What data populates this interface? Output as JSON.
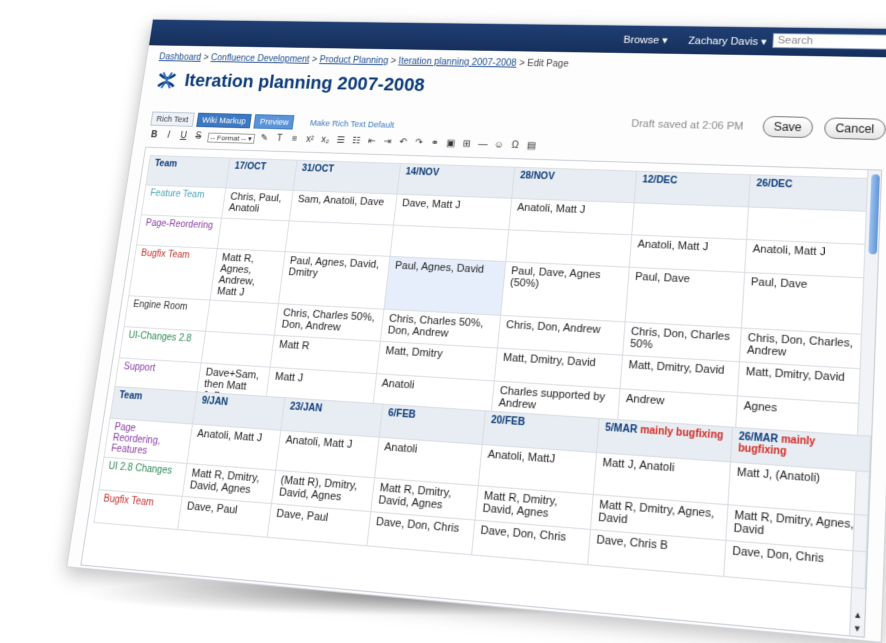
{
  "topbar": {
    "browse": "Browse ▾",
    "user": "Zachary Davis ▾",
    "search_placeholder": "Search"
  },
  "breadcrumb": {
    "items": [
      "Dashboard",
      "Confluence Development",
      "Product Planning",
      "Iteration planning 2007-2008"
    ],
    "sep": " > ",
    "current": "Edit Page"
  },
  "page_title": "Iteration planning 2007-2008",
  "editor_tabs": {
    "rich": "Rich Text",
    "wiki": "Wiki Markup",
    "preview": "Preview",
    "make_default": "Make Rich Text Default"
  },
  "draft_status": "Draft saved at 2:06 PM",
  "buttons": {
    "save": "Save",
    "cancel": "Cancel"
  },
  "format_select": "-- Format -- ▾",
  "colors": {
    "accent": "#0b3a78",
    "link": "#3560a9",
    "highlight": "#d22a22"
  },
  "table1": {
    "headers": [
      "Team",
      "17/OCT",
      "31/OCT",
      "14/NOV",
      "28/NOV",
      "12/DEC",
      "26/DEC"
    ],
    "rows": [
      [
        "Feature Team",
        "Chris, Paul, Anatoli",
        "Sam, Anatoli, Dave",
        "Dave, Matt J",
        "Anatoli, Matt J",
        "",
        ""
      ],
      [
        "Page-Reordering",
        "",
        "",
        "",
        "",
        "Anatoli, Matt J",
        "Anatoli, Matt J"
      ],
      [
        "Bugfix Team",
        "Matt R, Agnes, Andrew, Matt J",
        "Paul, Agnes, David, Dmitry",
        "Paul, Agnes, David",
        "Paul, Dave, Agnes (50%)",
        "Paul, Dave",
        "Paul, Dave"
      ],
      [
        "Engine Room",
        "",
        "Chris, Charles 50%, Don, Andrew",
        "Chris, Charles 50%, Don, Andrew",
        "Chris, Don, Andrew",
        "Chris, Don, Charles 50%",
        "Chris, Don, Charles, Andrew"
      ],
      [
        "UI-Changes 2.8",
        "",
        "Matt R",
        "Matt, Dmitry",
        "Matt, Dmitry, David",
        "Matt, Dmitry, David",
        "Matt, Dmitry, David"
      ],
      [
        "Support",
        "Dave+Sam, then Matt J+Don",
        "Matt J",
        "Anatoli",
        "Charles supported by Andrew",
        "Andrew",
        "Agnes"
      ]
    ]
  },
  "table2": {
    "headers": [
      "Team",
      "9/JAN",
      "23/JAN",
      "6/FEB",
      "20/FEB",
      "5/MAR",
      "26/MAR"
    ],
    "header_notes": {
      "5": "mainly bugfixing",
      "6": "mainly bugfixing"
    },
    "rows": [
      [
        "Page Reordering, Features",
        "Anatoli, Matt J",
        "Anatoli, Matt J",
        "Anatoli",
        "Anatoli, MattJ",
        "Matt J, Anatoli",
        "Matt J, (Anatoli)"
      ],
      [
        "UI 2.8 Changes",
        "Matt R, Dmitry, David, Agnes",
        "(Matt R), Dmitry, David, Agnes",
        "Matt R, Dmitry, David, Agnes",
        "Matt R, Dmitry, David, Agnes",
        "Matt R, Dmitry, Agnes, David",
        "Matt R, Dmitry, Agnes, David"
      ],
      [
        "Bugfix Team",
        "Dave, Paul",
        "Dave, Paul",
        "Dave, Don, Chris",
        "Dave, Don, Chris",
        "Dave, Chris B",
        "Dave, Don, Chris"
      ]
    ]
  }
}
